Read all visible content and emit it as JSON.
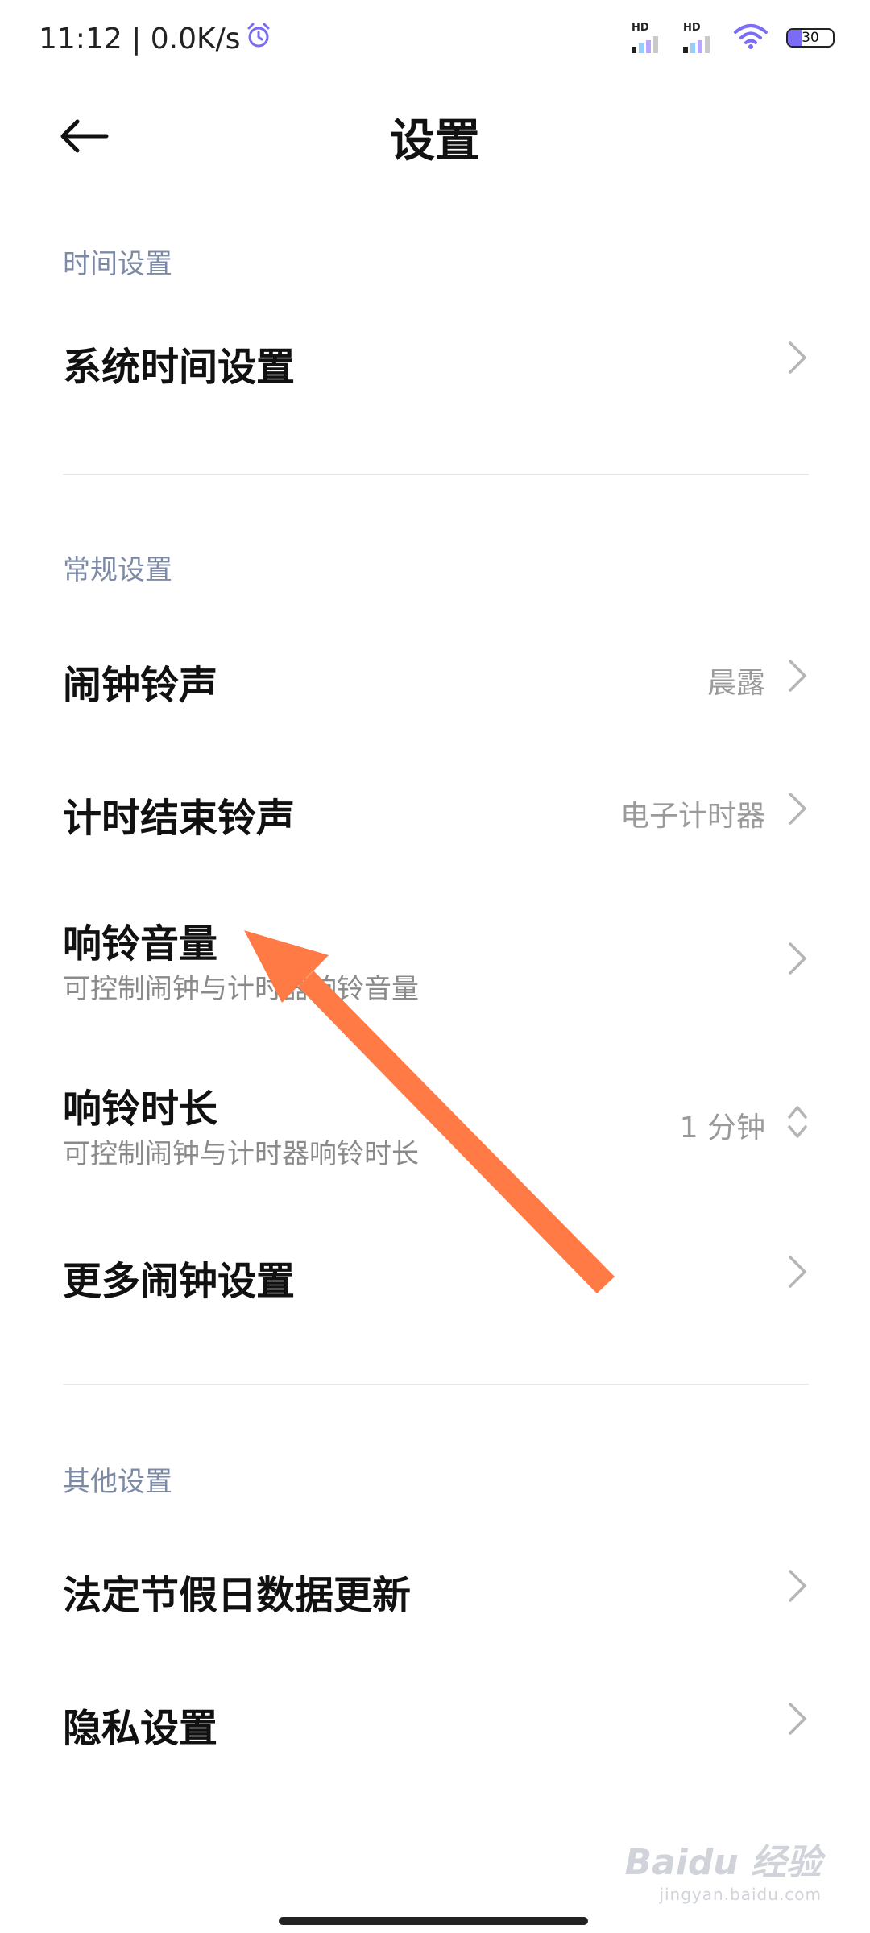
{
  "status_bar": {
    "time_speed": "11:12 | 0.0K/s",
    "sim1_label": "HD",
    "sim2_label": "HD",
    "battery_level": "30",
    "battery_fraction": 0.3,
    "alarm_icon_color": "#7b6cf6",
    "wifi_icon_color": "#7b6cf6"
  },
  "header": {
    "title": "设置",
    "back_icon": "arrow-left-icon"
  },
  "sections": [
    {
      "label": "时间设置",
      "items": [
        {
          "title": "系统时间设置",
          "value": "",
          "subtitle": ""
        }
      ]
    },
    {
      "label": "常规设置",
      "items": [
        {
          "title": "闹钟铃声",
          "value": "晨露",
          "subtitle": ""
        },
        {
          "title": "计时结束铃声",
          "value": "电子计时器",
          "subtitle": ""
        },
        {
          "title": "响铃音量",
          "value": "",
          "subtitle": "可控制闹钟与计时器响铃音量"
        },
        {
          "title": "响铃时长",
          "value": "1 分钟",
          "subtitle": "可控制闹钟与计时器响铃时长"
        },
        {
          "title": "更多闹钟设置",
          "value": "",
          "subtitle": ""
        }
      ]
    },
    {
      "label": "其他设置",
      "items": [
        {
          "title": "法定节假日数据更新",
          "value": "",
          "subtitle": ""
        },
        {
          "title": "隐私设置",
          "value": "",
          "subtitle": ""
        }
      ]
    }
  ],
  "annotation": {
    "arrow_color": "#ff7a45"
  },
  "watermark": {
    "main": "Baidu 经验",
    "sub": "jingyan.baidu.com"
  }
}
